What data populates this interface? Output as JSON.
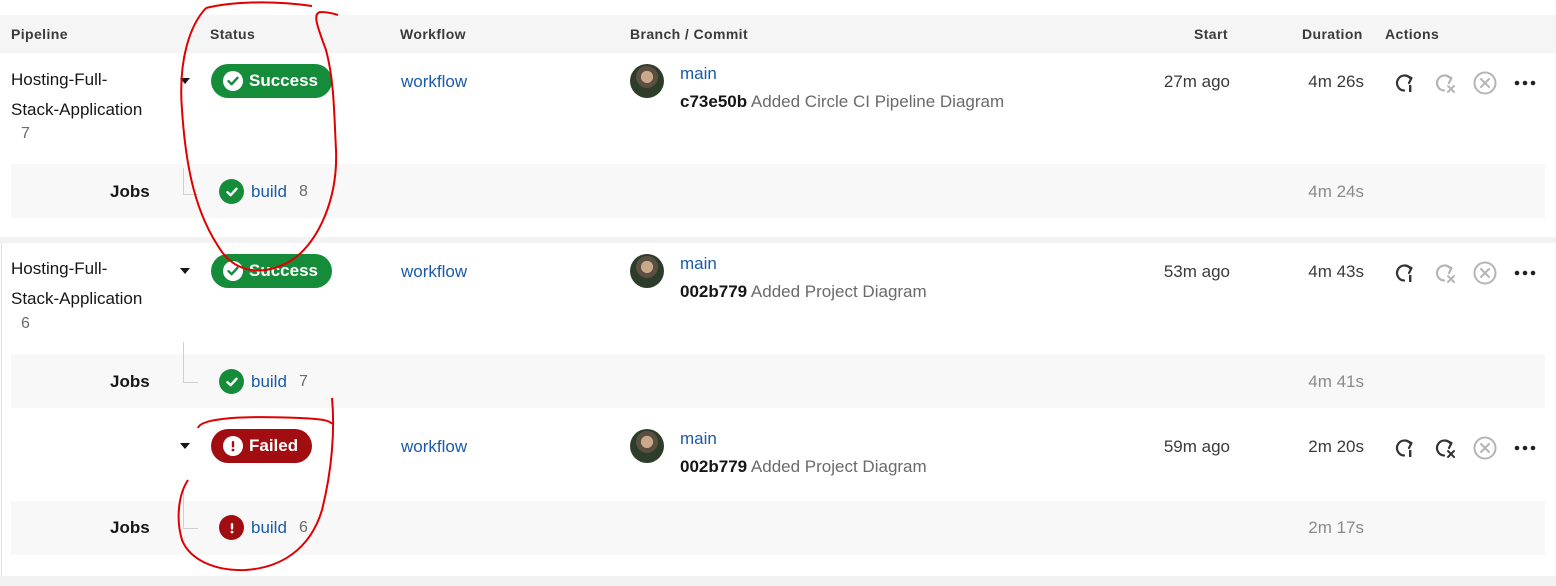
{
  "header": {
    "pipeline": "Pipeline",
    "status": "Status",
    "workflow": "Workflow",
    "branch_commit": "Branch / Commit",
    "start": "Start",
    "duration": "Duration",
    "actions": "Actions"
  },
  "rows": [
    {
      "pipeline_name_1": "Hosting-Full-",
      "pipeline_name_2": "Stack-Application",
      "pipeline_number": "7",
      "status": "Success",
      "workflow": "workflow",
      "branch": "main",
      "commit_hash": "c73e50b",
      "commit_message": "Added Circle CI Pipeline Diagram",
      "start": "27m ago",
      "duration": "4m 26s",
      "jobs_label": "Jobs",
      "job_name": "build",
      "job_number": "8",
      "job_duration": "4m 24s"
    },
    {
      "pipeline_name_1": "Hosting-Full-",
      "pipeline_name_2": "Stack-Application",
      "pipeline_number": "6",
      "status": "Success",
      "workflow": "workflow",
      "branch": "main",
      "commit_hash": "002b779",
      "commit_message": "Added Project Diagram",
      "start": "53m ago",
      "duration": "4m 43s",
      "jobs_label": "Jobs",
      "job_name": "build",
      "job_number": "7",
      "job_duration": "4m 41s"
    },
    {
      "status": "Failed",
      "workflow": "workflow",
      "branch": "main",
      "commit_hash": "002b779",
      "commit_message": "Added Project Diagram",
      "start": "59m ago",
      "duration": "2m 20s",
      "jobs_label": "Jobs",
      "job_name": "build",
      "job_number": "6",
      "job_duration": "2m 17s"
    }
  ],
  "icons": {
    "rerun": "rerun-icon",
    "rerun_failed": "rerun-failed-icon",
    "cancel": "cancel-icon",
    "more": "more-icon",
    "success": "check-circle-icon",
    "failed": "exclamation-circle-icon",
    "expand": "caret-down-icon"
  },
  "colors": {
    "success": "#158c3a",
    "failed": "#a10d10",
    "link": "#1a5aa8",
    "annotation": "#e00000"
  }
}
